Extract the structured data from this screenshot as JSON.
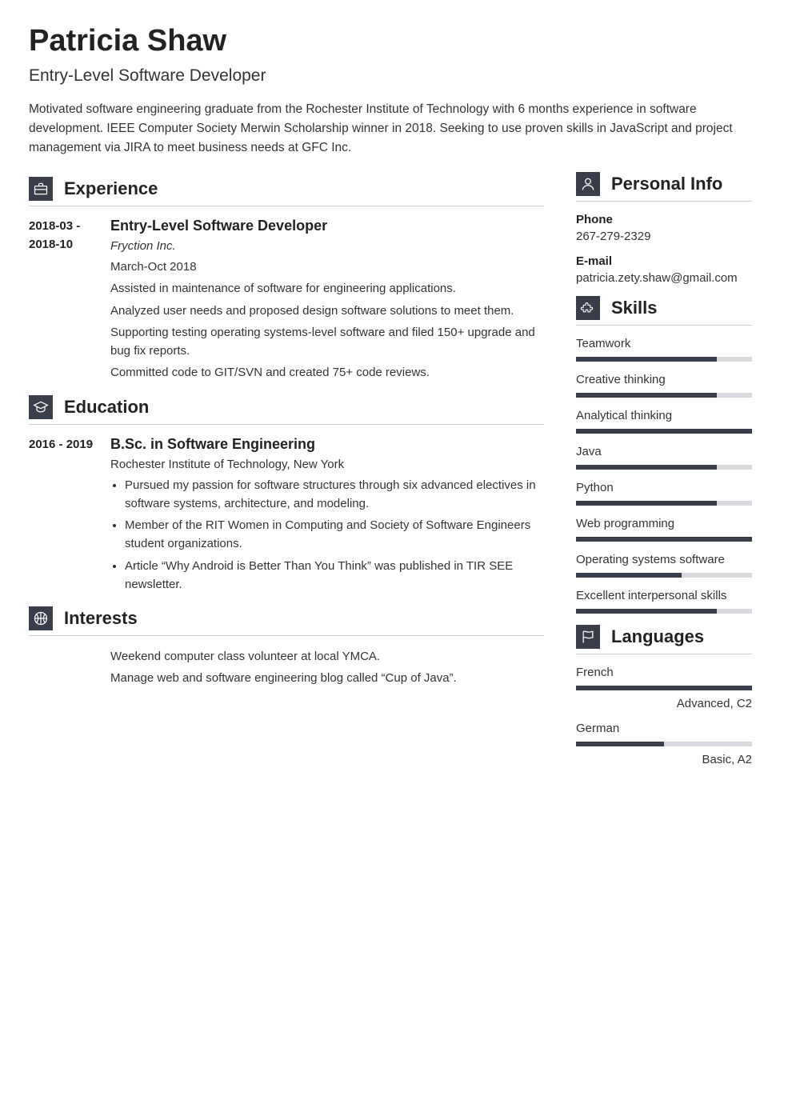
{
  "header": {
    "name": "Patricia Shaw",
    "title": "Entry-Level Software Developer",
    "summary": "Motivated software engineering graduate from the Rochester Institute of Technology with 6 months experience in software development. IEEE Computer Society Merwin Scholarship winner in 2018. Seeking to use proven skills in JavaScript and project management via JIRA to meet business needs at GFC Inc."
  },
  "sections": {
    "experience_title": "Experience",
    "education_title": "Education",
    "interests_title": "Interests",
    "personal_info_title": "Personal Info",
    "skills_title": "Skills",
    "languages_title": "Languages"
  },
  "experience": [
    {
      "dates": "2018-03 - 2018-10",
      "title": "Entry-Level Software Developer",
      "company": "Fryction Inc.",
      "period": "March-Oct 2018",
      "lines": [
        "Assisted in maintenance of software for engineering applications.",
        "Analyzed user needs and proposed design software solutions to meet them.",
        "Supporting testing operating systems-level software and filed 150+ upgrade and bug fix reports.",
        "Committed code to GIT/SVN and created 75+ code reviews."
      ]
    }
  ],
  "education": [
    {
      "dates": "2016 - 2019",
      "title": "B.Sc. in Software Engineering",
      "school": "Rochester Institute of Technology, New York",
      "bullets": [
        "Pursued my passion for software structures through six advanced electives in software systems, architecture, and modeling.",
        "Member of the RIT Women in Computing and Society of Software Engineers student organizations.",
        "Article “Why Android is Better Than You Think” was published in TIR SEE newsletter."
      ]
    }
  ],
  "interests": [
    "Weekend computer class volunteer at local YMCA.",
    "Manage web and software engineering blog called “Cup of Java”."
  ],
  "personal_info": {
    "phone_label": "Phone",
    "phone": "267-279-2329",
    "email_label": "E-mail",
    "email": "patricia.zety.shaw@gmail.com"
  },
  "skills": [
    {
      "name": "Teamwork",
      "percent": 80
    },
    {
      "name": "Creative thinking",
      "percent": 80
    },
    {
      "name": "Analytical thinking",
      "percent": 100
    },
    {
      "name": "Java",
      "percent": 80
    },
    {
      "name": "Python",
      "percent": 80
    },
    {
      "name": "Web programming",
      "percent": 100
    },
    {
      "name": "Operating systems software",
      "percent": 60
    },
    {
      "name": "Excellent interpersonal skills",
      "percent": 80
    }
  ],
  "languages": [
    {
      "name": "French",
      "percent": 100,
      "level": "Advanced, C2"
    },
    {
      "name": "German",
      "percent": 50,
      "level": "Basic, A2"
    }
  ]
}
